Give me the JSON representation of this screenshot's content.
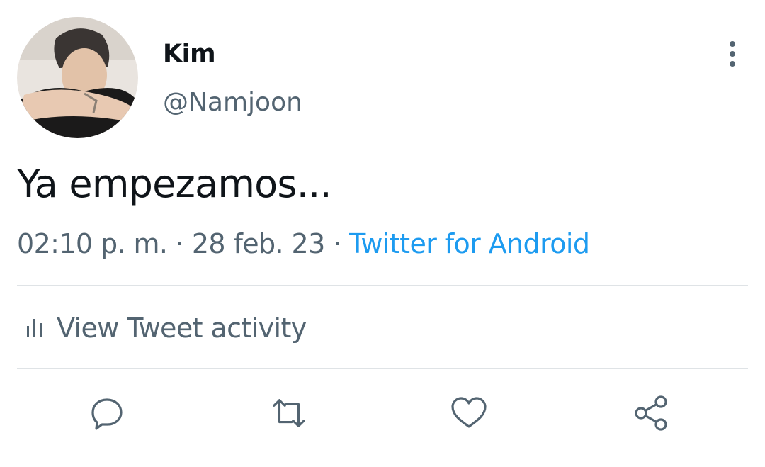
{
  "author": {
    "name": "Kim",
    "handle": "@Namjoon",
    "avatar_icon": "profile-photo"
  },
  "tweet": {
    "text": "Ya empezamos...",
    "time": "02:10 p. m.",
    "separator": "·",
    "date": "28 feb. 23",
    "source": "Twitter for Android"
  },
  "activity": {
    "label": "View Tweet activity",
    "icon": "bar-chart-icon"
  },
  "actions": [
    {
      "icon": "reply-icon"
    },
    {
      "icon": "retweet-icon"
    },
    {
      "icon": "like-icon"
    },
    {
      "icon": "share-icon"
    }
  ],
  "colors": {
    "text": "#0f1419",
    "secondary": "#536471",
    "link": "#1d9bf0",
    "divider": "#dfe3e6"
  }
}
